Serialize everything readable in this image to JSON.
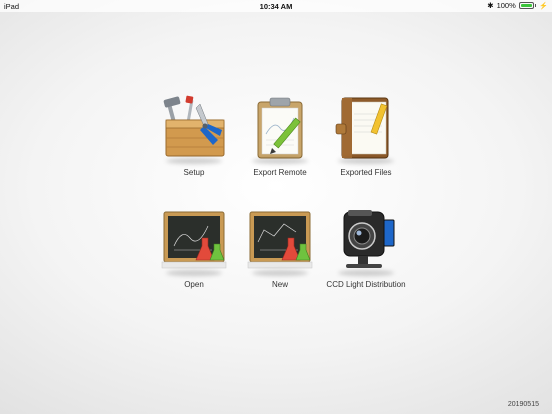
{
  "status": {
    "device": "iPad",
    "time": "10:34 AM",
    "battery": "100%"
  },
  "tiles": [
    {
      "label": "Setup",
      "icon": "toolbox-icon"
    },
    {
      "label": "Export Remote",
      "icon": "clipboard-pencil-icon"
    },
    {
      "label": "Exported Files",
      "icon": "notebook-icon"
    },
    {
      "label": "Open",
      "icon": "chalkboard-flask-icon"
    },
    {
      "label": "New",
      "icon": "chalkboard-flask-icon"
    },
    {
      "label": "CCD Light Distribution",
      "icon": "camcorder-icon"
    }
  ],
  "footer": {
    "version": "20190515"
  },
  "colors": {
    "wood": "#d29a4e",
    "chalkboard": "#2b2f2b",
    "flask_red": "#e24a3b",
    "flask_green": "#6fc23f"
  }
}
